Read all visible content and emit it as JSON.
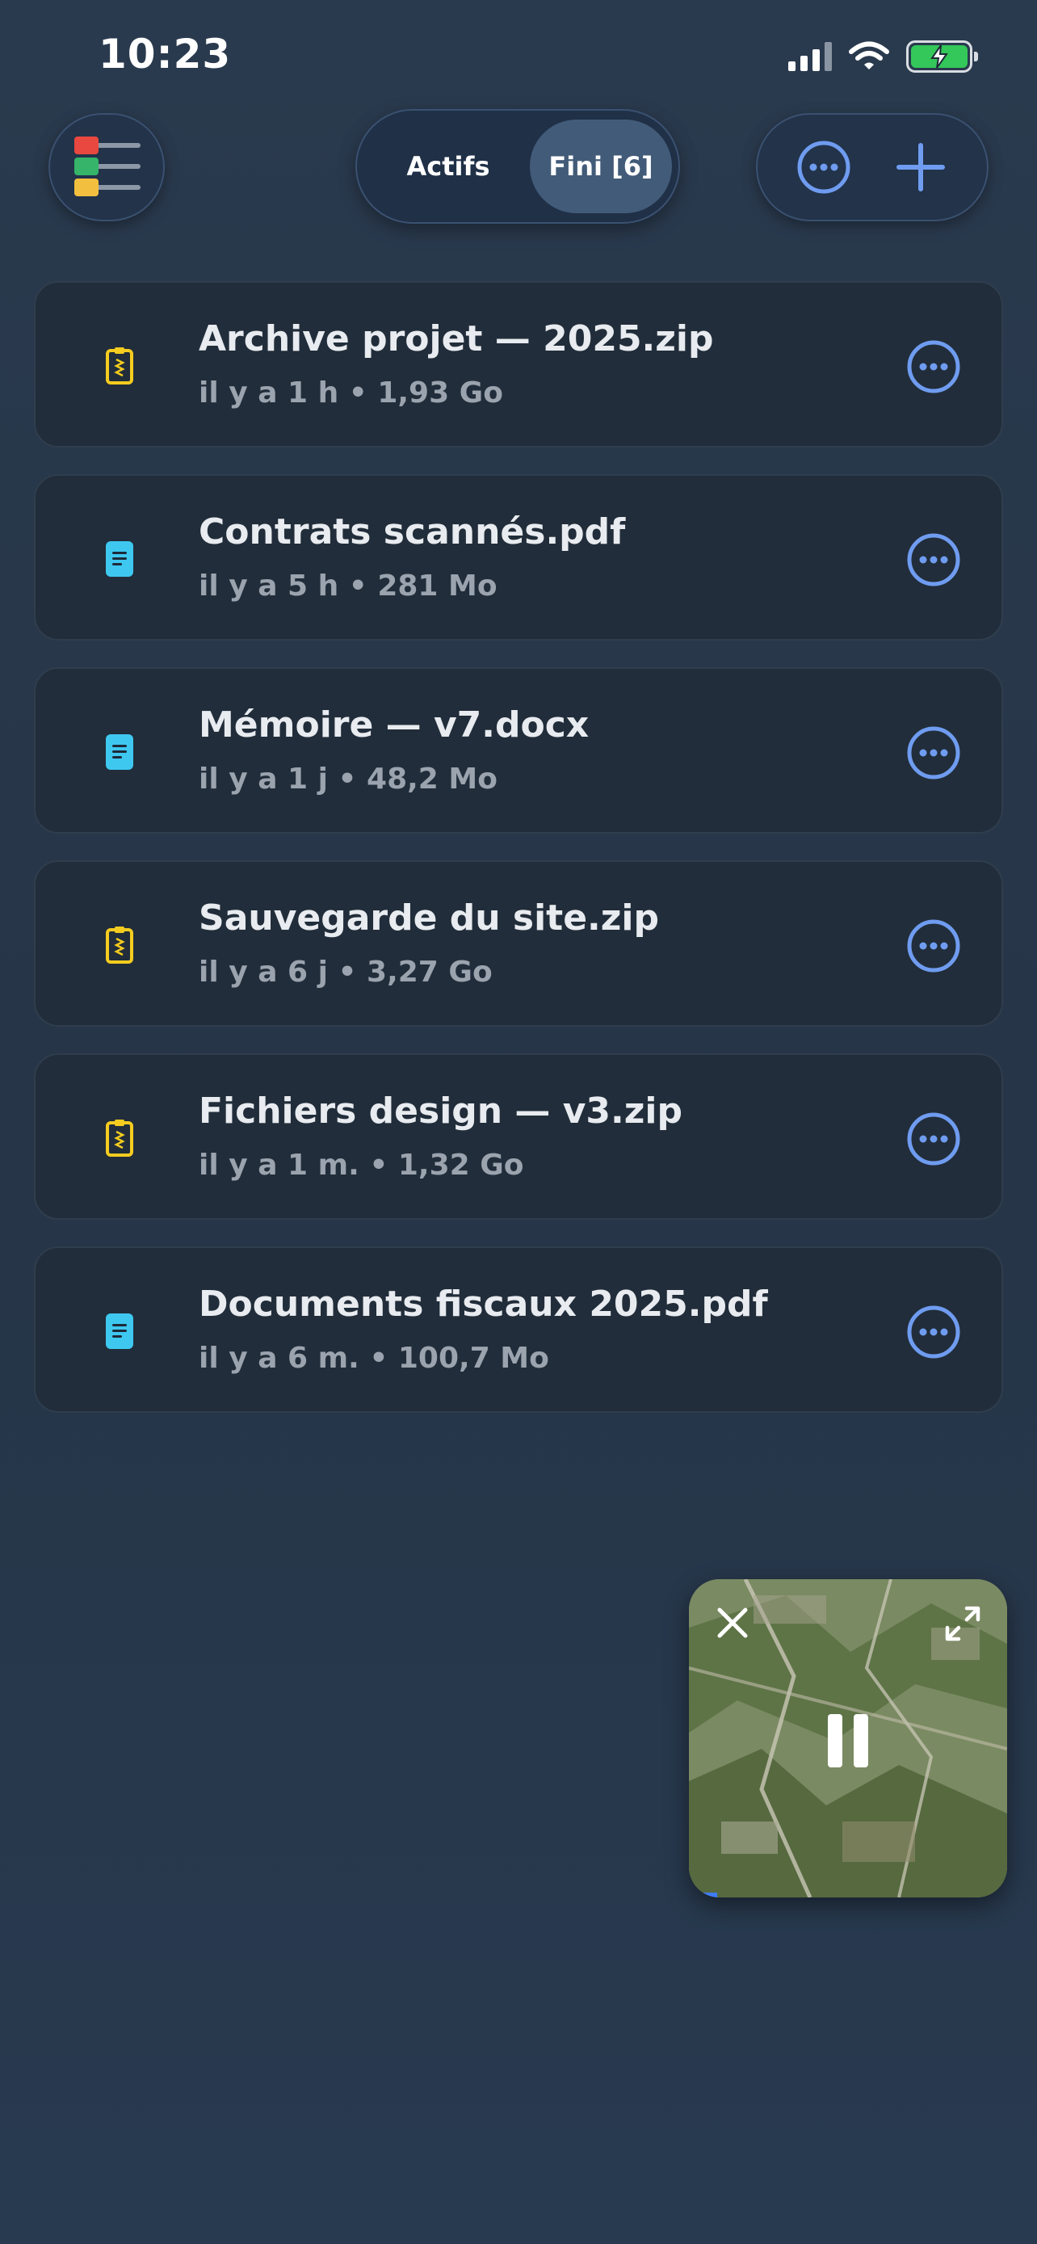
{
  "status_bar": {
    "time": "10:23"
  },
  "toolbar": {
    "tab_active": "Actifs",
    "tab_done": "Fini [6]"
  },
  "files": [
    {
      "name": "Archive projet — 2025.zip",
      "meta": "il y a 1 h • 1,93 Go",
      "icon": "zip-icon"
    },
    {
      "name": "Contrats scannés.pdf",
      "meta": "il y a 5 h • 281 Mo",
      "icon": "document-icon"
    },
    {
      "name": "Mémoire — v7.docx",
      "meta": "il y a 1 j • 48,2 Mo",
      "icon": "document-icon"
    },
    {
      "name": "Sauvegarde du site.zip",
      "meta": "il y a 6 j • 3,27 Go",
      "icon": "zip-icon"
    },
    {
      "name": "Fichiers design — v3.zip",
      "meta": "il y a 1 m. • 1,32 Go",
      "icon": "zip-icon"
    },
    {
      "name": "Documents fiscaux 2025.pdf",
      "meta": "il y a 6 m. • 100,7 Mo",
      "icon": "document-icon"
    }
  ],
  "colors": {
    "accent": "#6f9cf0",
    "zip": "#f5cc1f",
    "doc": "#3ec8f0"
  },
  "pip": {
    "progress_fraction": 0.09
  }
}
